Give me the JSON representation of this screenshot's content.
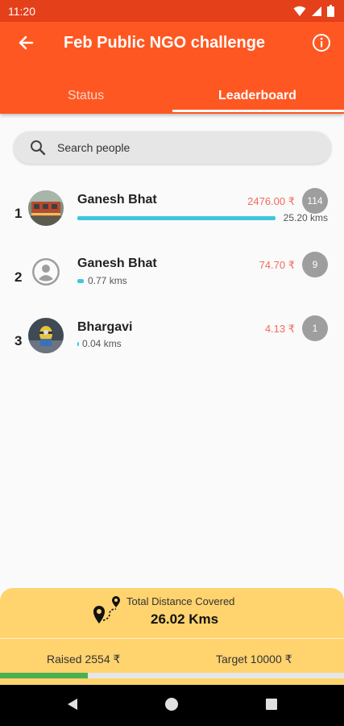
{
  "status_bar": {
    "time": "11:20",
    "icons": [
      "wifi-icon",
      "signal-icon",
      "battery-icon"
    ]
  },
  "app_bar": {
    "title": "Feb Public NGO challenge",
    "back_icon": "arrow-back-icon",
    "info_icon": "info-icon"
  },
  "tabs": [
    {
      "label": "Status",
      "selected": false
    },
    {
      "label": "Leaderboard",
      "selected": true
    }
  ],
  "search": {
    "placeholder": "Search people",
    "value": ""
  },
  "leaderboard": [
    {
      "rank": "1",
      "name": "Ganesh Bhat",
      "amount": "2476.00 ₹",
      "count": "114",
      "distance": "25.20 kms",
      "progress": 1.0,
      "avatar": "photo-train"
    },
    {
      "rank": "2",
      "name": "Ganesh Bhat",
      "amount": "74.70 ₹",
      "count": "9",
      "distance": "0.77 kms",
      "progress": 0.031,
      "avatar": "default-person"
    },
    {
      "rank": "3",
      "name": "Bhargavi",
      "amount": "4.13 ₹",
      "count": "1",
      "distance": "0.04 kms",
      "progress": 0.002,
      "avatar": "photo-toy"
    }
  ],
  "summary": {
    "label": "Total Distance Covered",
    "value": "26.02 Kms",
    "raised": "Raised 2554 ₹",
    "target": "Target 10000 ₹",
    "progress": 0.2554,
    "icon": "route-pin-icon"
  },
  "colors": {
    "primary": "#ff5722",
    "status_bar": "#e4401a",
    "accent": "#3cc8dc",
    "amount": "#f26b5b",
    "summary_bg": "#ffd36e",
    "progress": "#4caf50",
    "badge": "#9e9e9e"
  },
  "nav": {
    "icons": [
      "back-triangle-icon",
      "home-circle-icon",
      "recents-square-icon"
    ]
  }
}
